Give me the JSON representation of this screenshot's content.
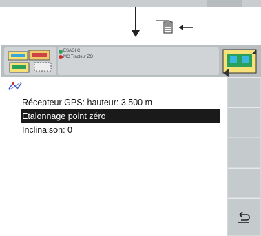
{
  "header": {
    "line1": "ESAGI C",
    "line2": "MC Tracteur ZO"
  },
  "menu": {
    "items": [
      {
        "label": "Récepteur GPS: hauteur: 3.500 m",
        "selected": false
      },
      {
        "label": "Etalonnage point zéro",
        "selected": true
      },
      {
        "label": "Inclinaison: 0",
        "selected": false
      }
    ]
  },
  "icons": {
    "tool": "implement-config-icon",
    "tractor": "tractor-status-icon",
    "calibration": "calibration-icon",
    "back": "back-icon",
    "callout": "callout-key-icon"
  }
}
